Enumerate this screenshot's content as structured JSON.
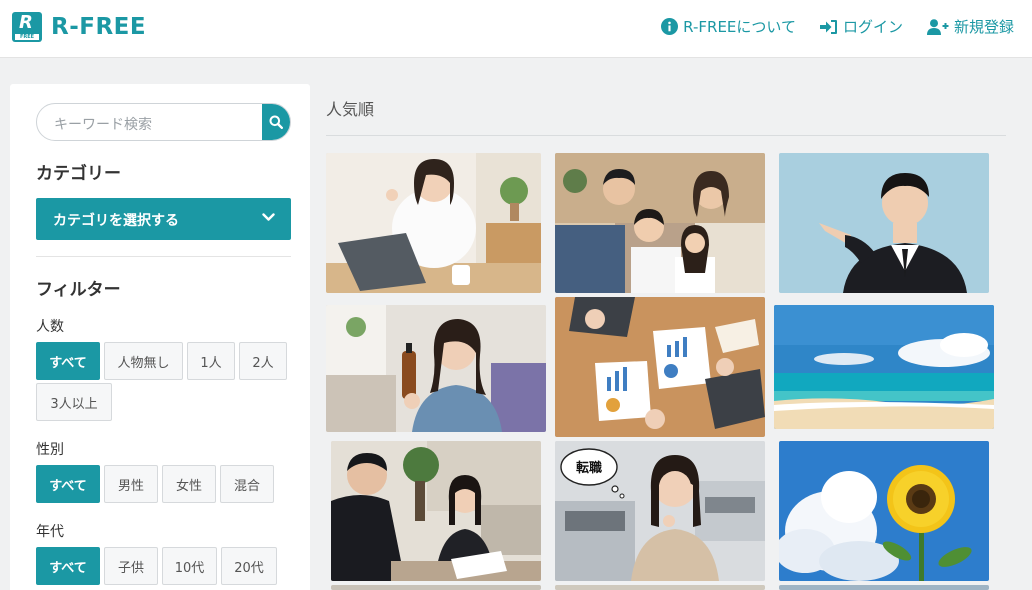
{
  "header": {
    "logo_letter": "R",
    "logo_sub": "FREE",
    "brand": "R-FREE",
    "nav": {
      "about": "R-FREEについて",
      "login": "ログイン",
      "signup": "新規登録"
    }
  },
  "sidebar": {
    "search_placeholder": "キーワード検索",
    "category_heading": "カテゴリー",
    "category_select": "カテゴリを選択する",
    "filter_heading": "フィルター",
    "people": {
      "label": "人数",
      "options": [
        "すべて",
        "人物無し",
        "1人",
        "2人",
        "3人以上"
      ]
    },
    "gender": {
      "label": "性別",
      "options": [
        "すべて",
        "男性",
        "女性",
        "混合"
      ]
    },
    "age": {
      "label": "年代",
      "options": [
        "すべて",
        "子供",
        "10代",
        "20代"
      ]
    }
  },
  "main": {
    "title": "人気順",
    "speech_bubble": "転職"
  },
  "colors": {
    "accent": "#1b98a4",
    "page_bg": "#f0f1f2"
  }
}
